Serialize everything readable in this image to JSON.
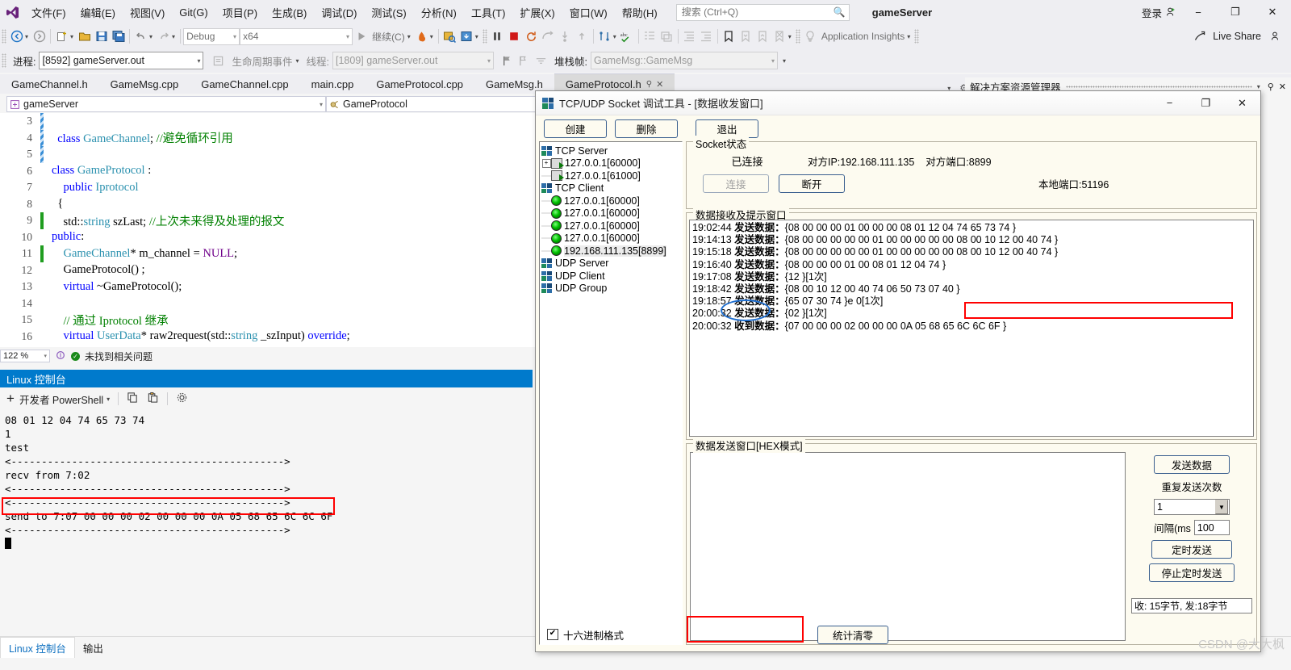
{
  "vs": {
    "menu_items": [
      "文件(F)",
      "编辑(E)",
      "视图(V)",
      "Git(G)",
      "项目(P)",
      "生成(B)",
      "调试(D)",
      "测试(S)",
      "分析(N)",
      "工具(T)",
      "扩展(X)",
      "窗口(W)",
      "帮助(H)"
    ],
    "search_placeholder": "搜索 (Ctrl+Q)",
    "title": "gameServer",
    "signin_label": "登录",
    "window_buttons": {
      "minimize": "−",
      "maximize": "❐",
      "close": "✕"
    },
    "toolbar": {
      "config": "Debug",
      "platform": "x64",
      "run_label": "继续(C)",
      "app_insights": "Application Insights",
      "live_share": "Live Share"
    },
    "debug_bar": {
      "process_label": "进程:",
      "process_value": "[8592] gameServer.out",
      "lifecycle_label": "生命周期事件",
      "thread_label": "线程:",
      "thread_value": "[1809] gameServer.out",
      "stack_label": "堆栈帧:",
      "stack_value": "GameMsg::GameMsg"
    },
    "tabs": [
      {
        "label": "GameChannel.h",
        "active": false
      },
      {
        "label": "GameMsg.cpp",
        "active": false
      },
      {
        "label": "GameChannel.cpp",
        "active": false
      },
      {
        "label": "main.cpp",
        "active": false
      },
      {
        "label": "GameProtocol.cpp",
        "active": false
      },
      {
        "label": "GameMsg.h",
        "active": false
      },
      {
        "label": "GameProtocol.h",
        "active": true
      }
    ],
    "navbar": {
      "scope": "gameServer",
      "member": "GameProtocol"
    },
    "solution_explorer_title": "解决方案资源管理器",
    "status": {
      "zoom": "122 %",
      "message": "未找到相关问题"
    },
    "bottom_tabs": [
      {
        "label": "Linux 控制台",
        "active": true
      },
      {
        "label": "输出",
        "active": false
      }
    ]
  },
  "code": {
    "lines": [
      {
        "num": "3",
        "marker": "stripe",
        "html": ""
      },
      {
        "num": "4",
        "marker": "stripe",
        "html": "  <span class='k'>class</span> <span class='t'>GameChannel</span>; <span class='cm'>//避免循环引用</span>"
      },
      {
        "num": "5",
        "marker": "stripe",
        "html": ""
      },
      {
        "num": "6",
        "marker": "none",
        "html": "<span class='k'>class</span> <span class='t'>GameProtocol</span> :"
      },
      {
        "num": "7",
        "marker": "none",
        "html": "    <span class='k'>public</span> <span class='t'>Iprotocol</span>"
      },
      {
        "num": "8",
        "marker": "none",
        "html": "  {"
      },
      {
        "num": "9",
        "marker": "green",
        "html": "    std::<span class='t'>string</span> szLast; <span class='cm'>//上次未来得及处理的报文</span>"
      },
      {
        "num": "10",
        "marker": "none",
        "html": "<span class='k'>public</span>:"
      },
      {
        "num": "11",
        "marker": "green",
        "html": "    <span class='t'>GameChannel</span>* m_channel = <span class='m'>NULL</span>;"
      },
      {
        "num": "12",
        "marker": "none",
        "html": "    GameProtocol() ;"
      },
      {
        "num": "13",
        "marker": "none",
        "html": "    <span class='k'>virtual</span> ~GameProtocol();"
      },
      {
        "num": "14",
        "marker": "none",
        "html": ""
      },
      {
        "num": "15",
        "marker": "none",
        "html": "    <span class='cm'>// 通过 Iprotocol 继承</span>"
      },
      {
        "num": "16",
        "marker": "none",
        "html": "    <span class='k'>virtual</span> <span class='t'>UserData</span>* raw2request(std::<span class='t'>string</span> _szInput) <span class='k'>override</span>;"
      }
    ]
  },
  "console": {
    "header": "Linux 控制台",
    "toolbar": {
      "add": "+",
      "shell_label": "开发者 PowerShell"
    },
    "output_lines": [
      "08 01 12 04 74 65 73 74",
      "1",
      "test",
      "<--------------------------------------------->",
      "recv from 7:02",
      "<--------------------------------------------->",
      "<--------------------------------------------->",
      "send to 7:07 00 00 00 02 00 00 00 0A 05 68 65 6C 6C 6F",
      "<--------------------------------------------->"
    ],
    "highlighted_line_index": 7
  },
  "dialog": {
    "title": "TCP/UDP Socket 调试工具 - [数据收发窗口]",
    "window_buttons": {
      "minimize": "−",
      "maximize": "❐",
      "close": "✕"
    },
    "toolbar_buttons": [
      {
        "label": "创建",
        "name": "create-button"
      },
      {
        "label": "删除",
        "name": "delete-button"
      },
      {
        "label": "退出",
        "name": "exit-button"
      }
    ],
    "tree": [
      {
        "label": "TCP Server",
        "type": "group",
        "indent": 0,
        "expander": "",
        "selected": false
      },
      {
        "label": "127.0.0.1[60000]",
        "type": "server",
        "indent": 1,
        "expander": "+",
        "selected": false
      },
      {
        "label": "127.0.0.1[61000]",
        "type": "server",
        "indent": 1,
        "expander": "",
        "selected": false
      },
      {
        "label": "TCP Client",
        "type": "group",
        "indent": 0,
        "expander": "",
        "selected": false
      },
      {
        "label": "127.0.0.1[60000]",
        "type": "client",
        "indent": 1,
        "expander": "",
        "selected": false
      },
      {
        "label": "127.0.0.1[60000]",
        "type": "client",
        "indent": 1,
        "expander": "",
        "selected": false
      },
      {
        "label": "127.0.0.1[60000]",
        "type": "client",
        "indent": 1,
        "expander": "",
        "selected": false
      },
      {
        "label": "127.0.0.1[60000]",
        "type": "client",
        "indent": 1,
        "expander": "",
        "selected": false
      },
      {
        "label": "192.168.111.135[8899]",
        "type": "client",
        "indent": 1,
        "expander": "",
        "selected": true
      },
      {
        "label": "UDP Server",
        "type": "group",
        "indent": 0,
        "expander": "",
        "selected": false
      },
      {
        "label": "UDP Client",
        "type": "group",
        "indent": 0,
        "expander": "",
        "selected": false
      },
      {
        "label": "UDP Group",
        "type": "group",
        "indent": 0,
        "expander": "",
        "selected": false
      }
    ],
    "socket_status": {
      "legend": "Socket状态",
      "state": "已连接",
      "peer_ip": "对方IP:192.168.111.135",
      "peer_port": "对方端口:8899",
      "local_port": "本地端口:51196",
      "connect_button": "连接",
      "disconnect_button": "断开"
    },
    "receive": {
      "legend": "数据接收及提示窗口",
      "lines": [
        {
          "time": "19:02:44",
          "kind": "发送数据：",
          "payload": "{08 00 00 00 01 00 00 00 08 01 12 04 74 65 73 74 }"
        },
        {
          "time": "19:14:13",
          "kind": "发送数据：",
          "payload": "{08 00 00 00 00 00 01 00 00 00 00 00 08 00 10 12 00 40 74 }"
        },
        {
          "time": "19:15:18",
          "kind": "发送数据：",
          "payload": "{08 00 00 00 00 00 01 00 00 00 00 00 08 00 10 12 00 40 74 }"
        },
        {
          "time": "19:16:40",
          "kind": "发送数据：",
          "payload": "{08 00 00 00 01 00 08 01 12 04 74 }"
        },
        {
          "time": "19:17:08",
          "kind": "发送数据：",
          "payload": "{12 }[1次]"
        },
        {
          "time": "19:18:42",
          "kind": "发送数据：",
          "payload": "{08 00 10 12 00 40 74 06 50 73 07 40 }"
        },
        {
          "time": "19:18:57",
          "kind": "发送数据：",
          "payload": "{65 07 30 74 }e 0[1次]"
        },
        {
          "time": "20:00:32",
          "kind": "发送数据：",
          "payload": "{02 }[1次]"
        },
        {
          "time": "20:00:32",
          "kind": "收到数据：",
          "payload": "{07 00 00 00 02 00 00 00 0A 05 68 65 6C 6C 6F }"
        }
      ]
    },
    "send": {
      "legend": "数据发送窗口[HEX模式]",
      "text_value": "",
      "send_button": "发送数据",
      "repeat_label": "重复发送次数",
      "repeat_value": "1",
      "interval_label": "间隔(ms",
      "interval_value": "100",
      "timer_send_button": "定时发送",
      "stop_timer_button": "停止定时发送",
      "stats": "收: 15字节, 发:18字节"
    },
    "footer": {
      "hex_checkbox_label": "十六进制格式",
      "hex_checked": "✔",
      "clear_stats_button": "统计清零"
    }
  },
  "watermark": "CSDN @大大枫",
  "colors": {
    "accent_blue": "#007acc",
    "annotation_red": "#ff0000",
    "annotation_blue": "#1f6fd0",
    "dialog_bg": "#fdfbf0"
  }
}
